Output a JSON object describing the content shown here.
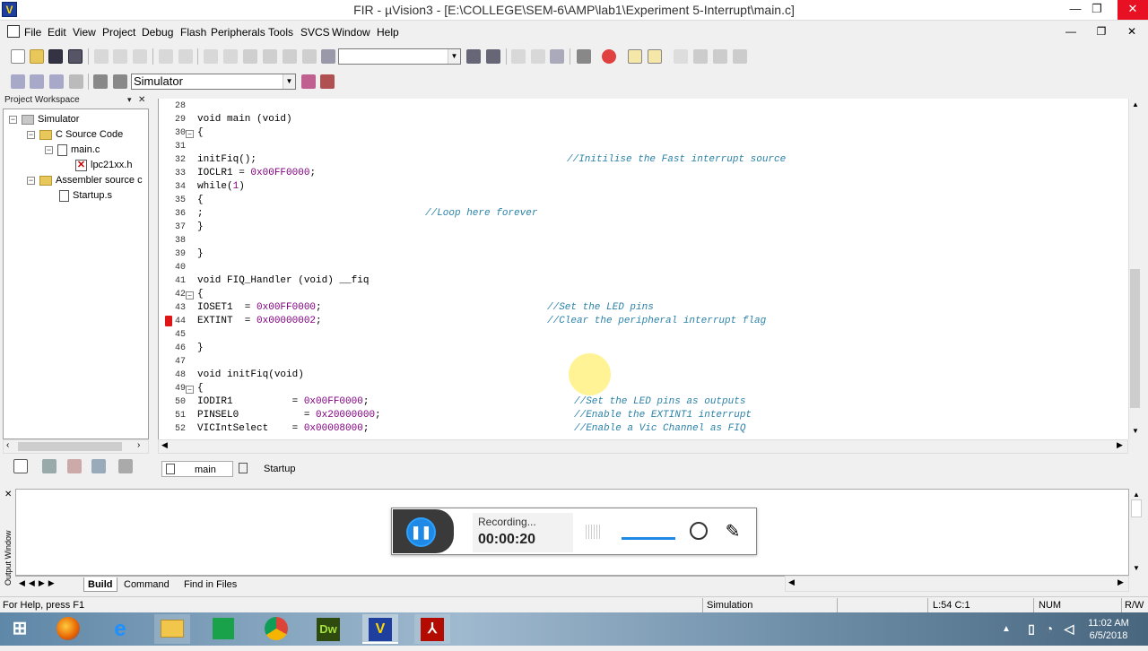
{
  "window": {
    "title": "FIR - µVision3 - [E:\\COLLEGE\\SEM-6\\AMP\\lab1\\Experiment 5-Interrupt\\main.c]",
    "minimize": "—",
    "maximize": "❐",
    "close": "✕"
  },
  "menu": [
    "File",
    "Edit",
    "View",
    "Project",
    "Debug",
    "Flash",
    "Peripherals",
    "Tools",
    "SVCS",
    "Window",
    "Help"
  ],
  "mdi_buttons": [
    "—",
    "❐",
    "✕"
  ],
  "toolbar": {
    "find_combo_value": "",
    "target_combo_value": "Simulator"
  },
  "workspace": {
    "header": "Project Workspace",
    "close": "✕",
    "tree": [
      {
        "label": "Simulator",
        "type": "project",
        "expanded": true
      },
      {
        "label": "C Source Code",
        "type": "folder",
        "expanded": true
      },
      {
        "label": "main.c",
        "type": "file",
        "expanded": true
      },
      {
        "label": "lpc21xx.h",
        "type": "header"
      },
      {
        "label": "Assembler source c",
        "type": "folder",
        "expanded": true
      },
      {
        "label": "Startup.s",
        "type": "file"
      }
    ]
  },
  "editor": {
    "lines": [
      {
        "n": "28",
        "code": "",
        "comment": "",
        "fold": ""
      },
      {
        "n": "29",
        "code": "void main (void)",
        "comment": "",
        "fold": ""
      },
      {
        "n": "30",
        "code": "{",
        "comment": "",
        "fold": "−"
      },
      {
        "n": "31",
        "code": "",
        "comment": "",
        "fold": ""
      },
      {
        "n": "32",
        "code": "initFiq();",
        "comment": "//Initilise the Fast interrupt source",
        "fold": ""
      },
      {
        "n": "33",
        "code": "IOCLR1 = 0x00FF0000;",
        "comment": "",
        "fold": ""
      },
      {
        "n": "34",
        "code": "while(1)",
        "comment": "",
        "fold": ""
      },
      {
        "n": "35",
        "code": "{",
        "comment": "",
        "fold": ""
      },
      {
        "n": "36",
        "code": ";",
        "comment": "//Loop here forever",
        "fold": ""
      },
      {
        "n": "37",
        "code": "}",
        "comment": "",
        "fold": ""
      },
      {
        "n": "38",
        "code": "",
        "comment": "",
        "fold": ""
      },
      {
        "n": "39",
        "code": "}",
        "comment": "",
        "fold": ""
      },
      {
        "n": "40",
        "code": "",
        "comment": "",
        "fold": ""
      },
      {
        "n": "41",
        "code": "void FIQ_Handler (void) __fiq",
        "comment": "",
        "fold": ""
      },
      {
        "n": "42",
        "code": "{",
        "comment": "",
        "fold": "−"
      },
      {
        "n": "43",
        "code": "IOSET1  = 0x00FF0000;",
        "comment": "//Set the LED pins",
        "fold": ""
      },
      {
        "n": "44",
        "code": "EXTINT  = 0x00000002;",
        "comment": "//Clear the peripheral interrupt flag",
        "fold": ""
      },
      {
        "n": "45",
        "code": "",
        "comment": "",
        "fold": ""
      },
      {
        "n": "46",
        "code": "}",
        "comment": "",
        "fold": ""
      },
      {
        "n": "47",
        "code": "",
        "comment": "",
        "fold": ""
      },
      {
        "n": "48",
        "code": "void initFiq(void)",
        "comment": "",
        "fold": ""
      },
      {
        "n": "49",
        "code": "{",
        "comment": "",
        "fold": "−"
      },
      {
        "n": "50",
        "code": "IODIR1          = 0x00FF0000;",
        "comment": "//Set the LED pins as outputs",
        "fold": ""
      },
      {
        "n": "51",
        "code": "PINSEL0           = 0x20000000;",
        "comment": "//Enable the EXTINT1 interrupt",
        "fold": ""
      },
      {
        "n": "52",
        "code": "VICIntSelect    = 0x00008000;",
        "comment": "//Enable a Vic Channel as FIQ",
        "fold": ""
      }
    ],
    "breakpoint_line": "44",
    "tabs": [
      "main",
      "Startup"
    ]
  },
  "output": {
    "side_label": "Output Window",
    "close": "✕",
    "tabs": [
      "Build",
      "Command",
      "Find in Files"
    ]
  },
  "recorder": {
    "status": "Recording...",
    "timer": "00:00:20",
    "pause": "❚❚",
    "pen": "✎"
  },
  "statusbar": {
    "help": "For Help, press F1",
    "mode": "Simulation",
    "position": "L:54 C:1",
    "num": "NUM",
    "rw": "R/W"
  },
  "taskbar": {
    "apps": [
      "start",
      "firefox",
      "internet-explorer",
      "file-explorer",
      "store",
      "chrome",
      "dreamweaver",
      "uvision",
      "acrobat"
    ],
    "dreamweaver_label": "Dw",
    "time": "11:02 AM",
    "date": "6/5/2018"
  }
}
